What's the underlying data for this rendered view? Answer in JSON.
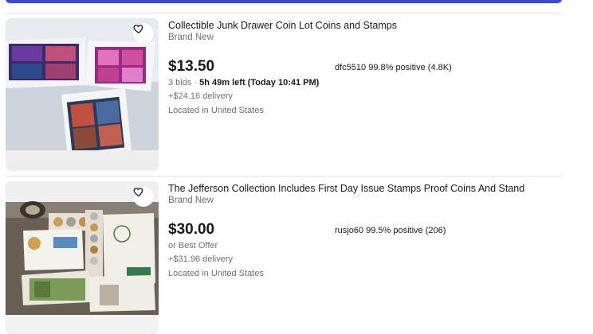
{
  "listings": [
    {
      "title": "Collectible Junk Drawer Coin Lot Coins and Stamps",
      "condition": "Brand New",
      "price": "$13.50",
      "seller": "dfc5510 99.8% positive (4.8K)",
      "bids": "3 bids",
      "time_left": "5h 49m left (Today 10:41 PM)",
      "delivery": "+$24.16 delivery",
      "location": "Located in United States"
    },
    {
      "title": "The Jefferson Collection Includes First Day Issue Stamps Proof Coins And Stand",
      "condition": "Brand New",
      "price": "$30.00",
      "seller": "rusjo60 99.5% positive (206)",
      "offer": "or Best Offer",
      "delivery": "+$31.96 delivery",
      "location": "Located in United States"
    }
  ],
  "colors": {
    "accent": "#3b4bd8",
    "text": "#191919",
    "muted": "#707070"
  },
  "icons": [
    "heart-icon"
  ]
}
